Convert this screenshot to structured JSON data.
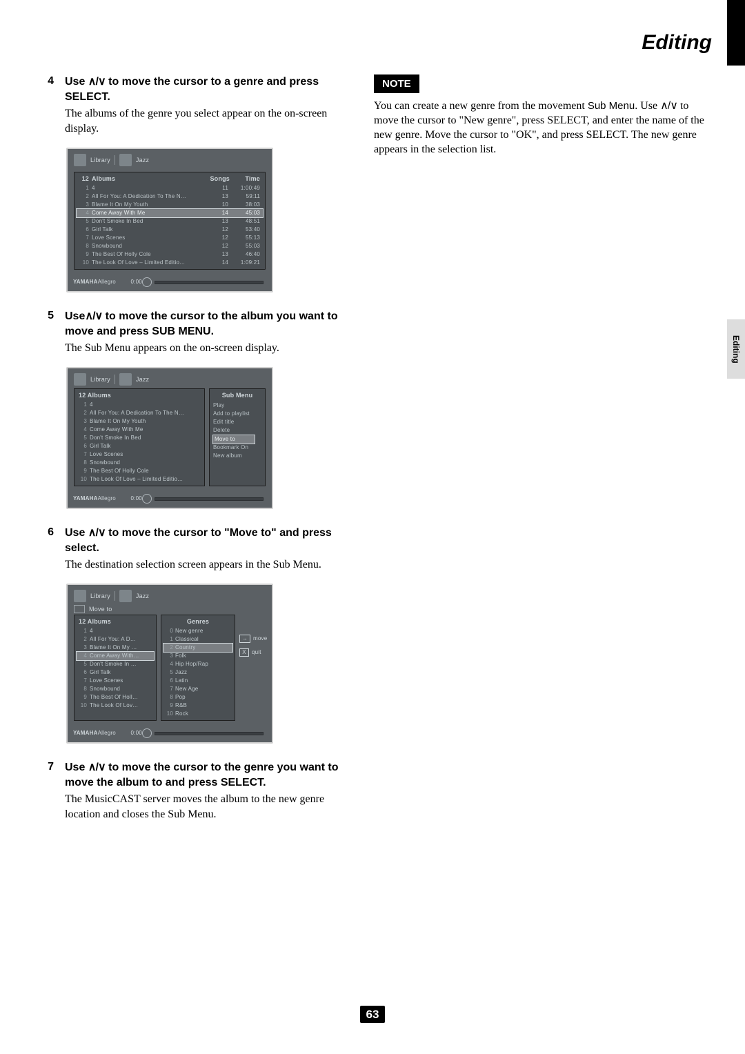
{
  "page_title": "Editing",
  "side_tab": "Editing",
  "page_number": "63",
  "arrow_glyph": "∧/∨",
  "steps": {
    "s4": {
      "num": "4",
      "title_pre": "Use ",
      "title_post": " to move the cursor to a genre and press SELECT.",
      "desc": "The albums of the genre you select appear on the on-screen display."
    },
    "s5": {
      "num": "5",
      "title_pre": "Use",
      "title_post": " to move the cursor to the album you want to move and press SUB MENU.",
      "desc": "The Sub Menu appears on the on-screen display."
    },
    "s6": {
      "num": "6",
      "title_pre": "Use ",
      "title_post": " to move the cursor to \"Move to\" and press select.",
      "desc": "The destination selection screen appears in the Sub Menu."
    },
    "s7": {
      "num": "7",
      "title_pre": "Use ",
      "title_post": " to move the cursor to the genre you want to move the album to and press SELECT.",
      "desc": "The MusicCAST server moves the album to the new genre location and closes the Sub Menu."
    }
  },
  "note": {
    "label": "NOTE",
    "text_a": "You can create a new genre from the movement ",
    "text_sub": "Sub Menu",
    "text_b": ". Use ",
    "text_c": " to move the cursor to \"New genre\", press SELECT, and enter the name of the new genre. Move the cursor to \"OK\", and press SELECT. The new genre appears in the selection list."
  },
  "osd_common": {
    "library": "Library",
    "category": "Jazz",
    "brand": "YAMAHA",
    "track": "Allegro",
    "time": "0:00"
  },
  "osd1": {
    "count_prefix": "12",
    "albums_label": "Albums",
    "songs_label": "Songs",
    "time_label": "Time",
    "rows": [
      {
        "n": "1",
        "title": "4",
        "songs": "11",
        "time": "1:00:49"
      },
      {
        "n": "2",
        "title": "All For You: A Dedication To The N…",
        "songs": "13",
        "time": "59:11"
      },
      {
        "n": "3",
        "title": "Blame It On My Youth",
        "songs": "10",
        "time": "38:03"
      },
      {
        "n": "4",
        "title": "Come Away With Me",
        "songs": "14",
        "time": "45:03",
        "sel": true
      },
      {
        "n": "5",
        "title": "Don't Smoke In Bed",
        "songs": "13",
        "time": "48:51"
      },
      {
        "n": "6",
        "title": "Girl Talk",
        "songs": "12",
        "time": "53:40"
      },
      {
        "n": "7",
        "title": "Love Scenes",
        "songs": "12",
        "time": "55:13"
      },
      {
        "n": "8",
        "title": "Snowbound",
        "songs": "12",
        "time": "55:03"
      },
      {
        "n": "9",
        "title": "The Best Of Holly Cole",
        "songs": "13",
        "time": "46:40"
      },
      {
        "n": "10",
        "title": "The Look Of Love – Limited Editio…",
        "songs": "14",
        "time": "1:09:21"
      }
    ]
  },
  "osd2": {
    "count_prefix": "12",
    "albums_label": "Albums",
    "rows": [
      {
        "n": "1",
        "title": "4"
      },
      {
        "n": "2",
        "title": "All For You: A Dedication To The N…"
      },
      {
        "n": "3",
        "title": "Blame It On My Youth"
      },
      {
        "n": "4",
        "title": "Come Away With Me"
      },
      {
        "n": "5",
        "title": "Don't Smoke In Bed"
      },
      {
        "n": "6",
        "title": "Girl Talk"
      },
      {
        "n": "7",
        "title": "Love Scenes"
      },
      {
        "n": "8",
        "title": "Snowbound"
      },
      {
        "n": "9",
        "title": "The Best Of Holly Cole"
      },
      {
        "n": "10",
        "title": "The Look Of Love – Limited Editio…"
      }
    ],
    "submenu_label": "Sub Menu",
    "submenu_items": [
      {
        "t": "Play"
      },
      {
        "t": "Add to playlist"
      },
      {
        "t": "Edit title"
      },
      {
        "t": "Delete"
      },
      {
        "t": "Move to",
        "sel": true
      },
      {
        "t": "Bookmark On"
      },
      {
        "t": "New album"
      }
    ]
  },
  "osd3": {
    "moveto_label": "Move to",
    "count_prefix": "12",
    "albums_label": "Albums",
    "albums": [
      {
        "n": "1",
        "title": "4"
      },
      {
        "n": "2",
        "title": "All For You: A D…"
      },
      {
        "n": "3",
        "title": "Blame It On My …"
      },
      {
        "n": "4",
        "title": "Come Away With…",
        "sel": true
      },
      {
        "n": "5",
        "title": "Don't Smoke In …"
      },
      {
        "n": "6",
        "title": "Girl Talk"
      },
      {
        "n": "7",
        "title": "Love Scenes"
      },
      {
        "n": "8",
        "title": "Snowbound"
      },
      {
        "n": "9",
        "title": "The Best Of Holl…"
      },
      {
        "n": "10",
        "title": "The Look Of Lov…"
      }
    ],
    "genres_label": "Genres",
    "genres": [
      {
        "n": "0",
        "title": "New genre"
      },
      {
        "n": "1",
        "title": "Classical"
      },
      {
        "n": "2",
        "title": "Country",
        "sel": true
      },
      {
        "n": "3",
        "title": "Folk"
      },
      {
        "n": "4",
        "title": "Hip Hop/Rap"
      },
      {
        "n": "5",
        "title": "Jazz"
      },
      {
        "n": "6",
        "title": "Latin"
      },
      {
        "n": "7",
        "title": "New Age"
      },
      {
        "n": "8",
        "title": "Pop"
      },
      {
        "n": "9",
        "title": "R&B"
      },
      {
        "n": "10",
        "title": "Rock"
      }
    ],
    "hint_move": "move",
    "hint_quit": "quit",
    "hint_arrow": "→",
    "hint_x": "X"
  }
}
